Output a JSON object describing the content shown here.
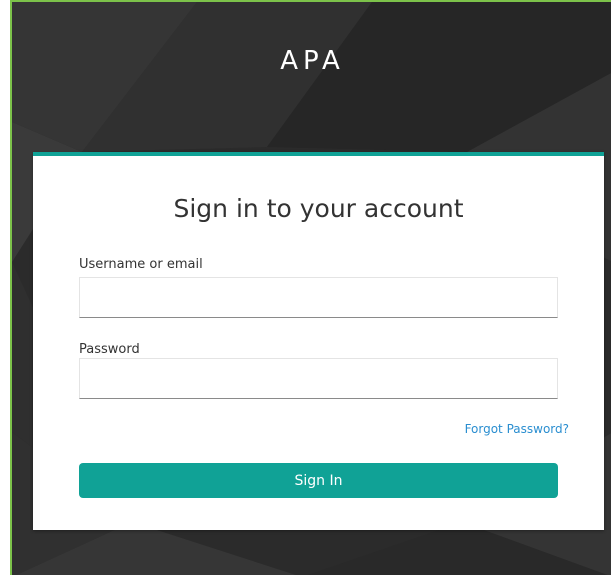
{
  "brand": {
    "title": "APA"
  },
  "login": {
    "heading": "Sign in to your account",
    "username_label": "Username or email",
    "username_value": "",
    "username_placeholder": "",
    "password_label": "Password",
    "password_value": "",
    "password_placeholder": "",
    "forgot_password_label": "Forgot Password?",
    "sign_in_label": "Sign In"
  },
  "colors": {
    "accent": "#10a296",
    "link": "#2a8ed0",
    "frame_border": "#7cc24a",
    "background": "#2d2d2d"
  }
}
